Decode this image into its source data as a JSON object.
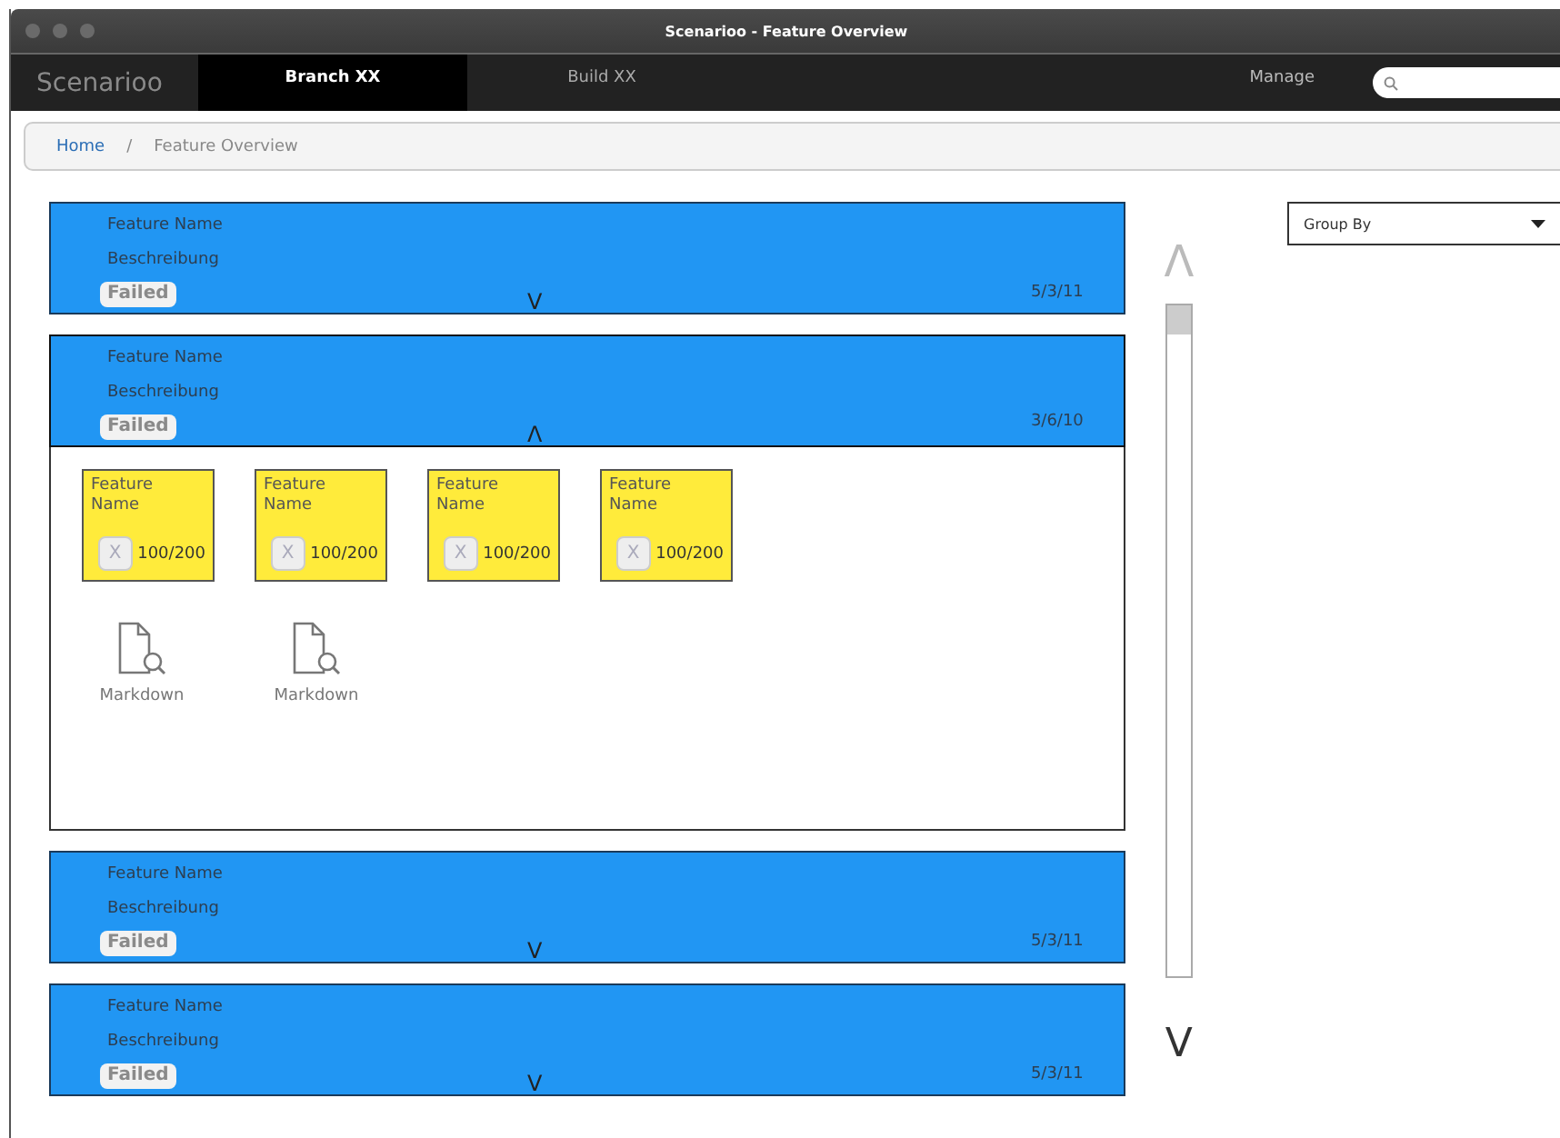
{
  "window": {
    "title": "Scenarioo - Feature Overview"
  },
  "nav": {
    "logo": "Scenarioo",
    "tabs": [
      {
        "label": "Branch XX",
        "selected": true
      },
      {
        "label": "Build XX",
        "selected": false
      }
    ],
    "manage": "Manage"
  },
  "breadcrumb": [
    {
      "label": "Home",
      "link": true
    },
    {
      "label": "/",
      "link": false
    },
    {
      "label": "Feature Overview",
      "link": false
    }
  ],
  "group_by": {
    "label": "Group By"
  },
  "scroller": {
    "up": "Λ",
    "down": "V"
  },
  "features": [
    {
      "name": "Feature Name",
      "description": "Beschreibung",
      "status": "Failed",
      "date": "5/3/11",
      "toggle": "V",
      "expanded": false
    },
    {
      "name": "Feature Name",
      "description": "Beschreibung",
      "status": "Failed",
      "date": "3/6/10",
      "toggle": "Λ",
      "expanded": true,
      "sub_features": [
        {
          "name": "Feature Name",
          "remove": "X",
          "count": "100/200"
        },
        {
          "name": "Feature Name",
          "remove": "X",
          "count": "100/200"
        },
        {
          "name": "Feature Name",
          "remove": "X",
          "count": "100/200"
        },
        {
          "name": "Feature Name",
          "remove": "X",
          "count": "100/200"
        }
      ],
      "documents": [
        {
          "label": "Markdown"
        },
        {
          "label": "Markdown"
        }
      ]
    },
    {
      "name": "Feature Name",
      "description": "Beschreibung",
      "status": "Failed",
      "date": "5/3/11",
      "toggle": "V",
      "expanded": false
    },
    {
      "name": "Feature Name",
      "description": "Beschreibung",
      "status": "Failed",
      "date": "5/3/11",
      "toggle": "V",
      "expanded": false
    }
  ]
}
